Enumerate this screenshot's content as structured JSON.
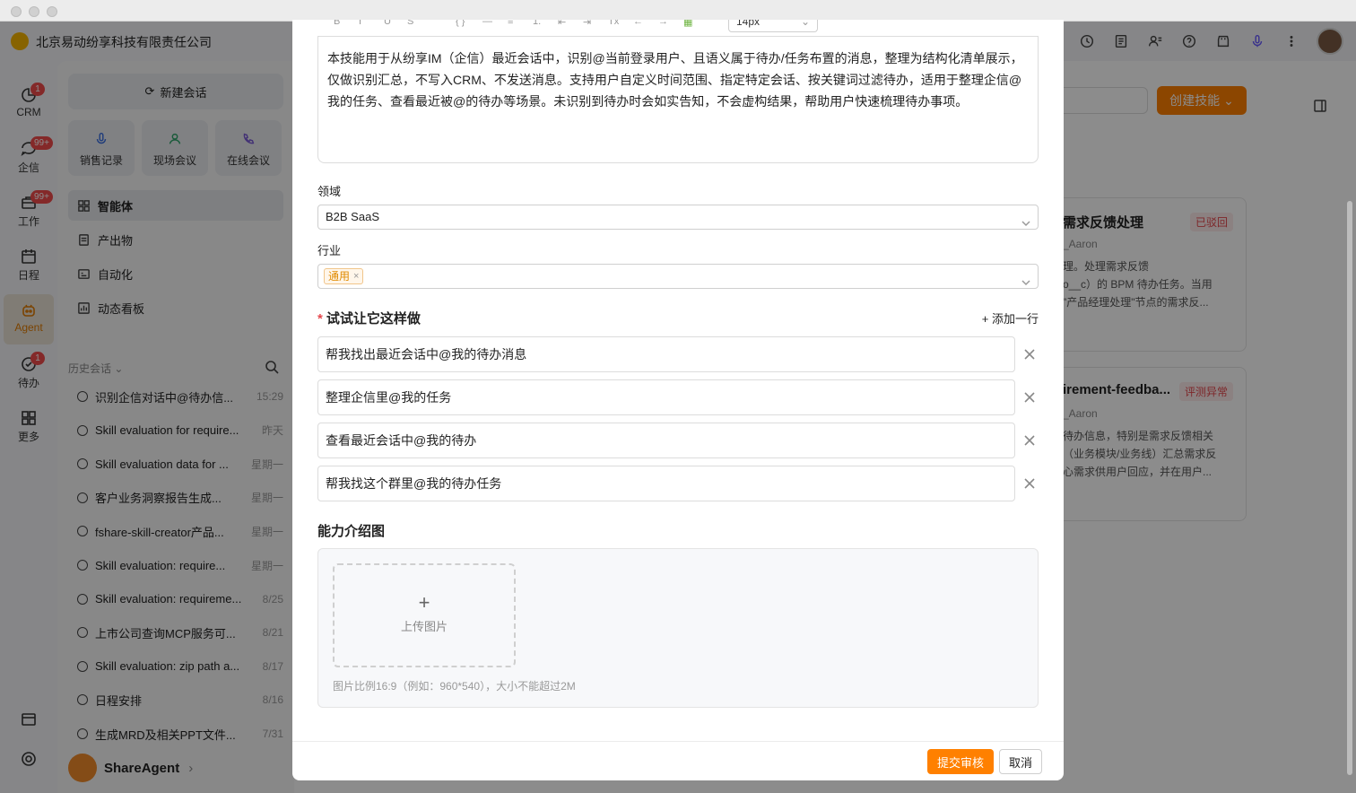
{
  "app": {
    "org_name": "北京易动纷享科技有限责任公司",
    "agent_name": "ShareAgent"
  },
  "nav": [
    {
      "label": "CRM",
      "badge": "1"
    },
    {
      "label": "企信",
      "badge": "99+"
    },
    {
      "label": "工作",
      "badge": "99+"
    },
    {
      "label": "日程",
      "badge": ""
    },
    {
      "label": "Agent",
      "badge": ""
    },
    {
      "label": "待办",
      "badge": "1"
    },
    {
      "label": "更多",
      "badge": ""
    }
  ],
  "sidebar": {
    "new_chat": "新建会话",
    "quick": [
      "销售记录",
      "现场会议",
      "在线会议"
    ],
    "menu": [
      "智能体",
      "产出物",
      "自动化",
      "动态看板"
    ],
    "history_title": "历史会话",
    "history": [
      {
        "title": "识别企信对话中@待办信...",
        "date": "15:29"
      },
      {
        "title": "Skill evaluation for require...",
        "date": "昨天"
      },
      {
        "title": "Skill evaluation data for ...",
        "date": "星期一"
      },
      {
        "title": "客户业务洞察报告生成...",
        "date": "星期一"
      },
      {
        "title": "fshare-skill-creator产品...",
        "date": "星期一"
      },
      {
        "title": "Skill evaluation: require...",
        "date": "星期一"
      },
      {
        "title": "Skill evaluation: requireme...",
        "date": "8/25"
      },
      {
        "title": "上市公司查询MCP服务可...",
        "date": "8/21"
      },
      {
        "title": "Skill evaluation: zip path a...",
        "date": "8/17"
      },
      {
        "title": "日程安排",
        "date": "8/16"
      },
      {
        "title": "生成MRD及相关PPT文件...",
        "date": "7/31"
      }
    ]
  },
  "background": {
    "create_button": "创建技能",
    "cards": [
      {
        "title": "需求反馈处理",
        "badge": "已驳回",
        "owner": "_Aaron",
        "desc": "理。处理需求反馈\no__c）的 BPM 待办任务。当用\n\"产品经理处理\"节点的需求反..."
      },
      {
        "title": "irement-feedba...",
        "badge": "评测异常",
        "owner": "_Aaron",
        "desc": "待办信息，特别是需求反馈相关\n（业务模块/业务线）汇总需求反\n心需求供用户回应，并在用户..."
      }
    ]
  },
  "modal": {
    "font_size": "14px",
    "description": "本技能用于从纷享IM（企信）最近会话中，识别@当前登录用户、且语义属于待办/任务布置的消息，整理为结构化清单展示，仅做识别汇总，不写入CRM、不发送消息。支持用户自定义时间范围、指定特定会话、按关键词过滤待办，适用于整理企信@我的任务、查看最近被@的待办等场景。未识别到待办时会如实告知，不会虚构结果，帮助用户快速梳理待办事项。",
    "domain_label": "领域",
    "domain_value": "B2B SaaS",
    "industry_label": "行业",
    "industry_tag": "通用",
    "examples_title": "试试让它这样做",
    "add_row": "+ 添加一行",
    "examples": [
      "帮我找出最近会话中@我的待办消息",
      "整理企信里@我的任务",
      "查看最近会话中@我的待办",
      "帮我找这个群里@我的待办任务"
    ],
    "image_title": "能力介绍图",
    "upload_plus": "+",
    "upload_label": "上传图片",
    "upload_hint": "图片比例16:9（例如：960*540），大小不能超过2M",
    "submit": "提交审核",
    "cancel": "取消"
  },
  "colors": {
    "accent": "#ff8000",
    "badge_red": "#f04b4b"
  }
}
